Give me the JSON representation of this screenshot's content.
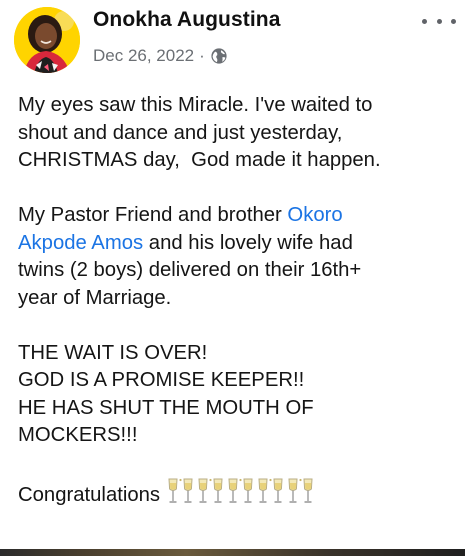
{
  "post": {
    "author": "Onokha Augustina",
    "date": "Dec 26, 2022",
    "separator": "·",
    "audience_icon": "globe-icon",
    "more_icon": "more-options-icon",
    "paragraph1": {
      "line1": "My eyes saw this Miracle. I've waited to",
      "line2": "shout and dance and just yesterday,",
      "line3": "CHRISTMAS day,  God made it happen."
    },
    "paragraph2": {
      "line1_text": "My Pastor Friend and brother ",
      "mention_part1": "Okoro",
      "mention_part2": "Akpode Amos",
      "line2_text": " and his lovely wife had",
      "line3": "twins (2 boys) delivered on their 16th+",
      "line4": "year of Marriage."
    },
    "paragraph3": {
      "line1": "THE WAIT IS OVER!",
      "line2": "GOD IS A PROMISE KEEPER!!",
      "line3": "HE HAS SHUT THE MOUTH OF",
      "line4": "MOCKERS!!!"
    },
    "closing": {
      "text": "Congratulations",
      "emoji": "🥂🥂🥂🥂🥂",
      "emoji_icon": "clinking-glasses-icon"
    }
  },
  "colors": {
    "author": "#111111",
    "meta": "#6b6f74",
    "body": "#151515",
    "link": "#1b74e4",
    "avatar_bg": "#ffd400"
  }
}
